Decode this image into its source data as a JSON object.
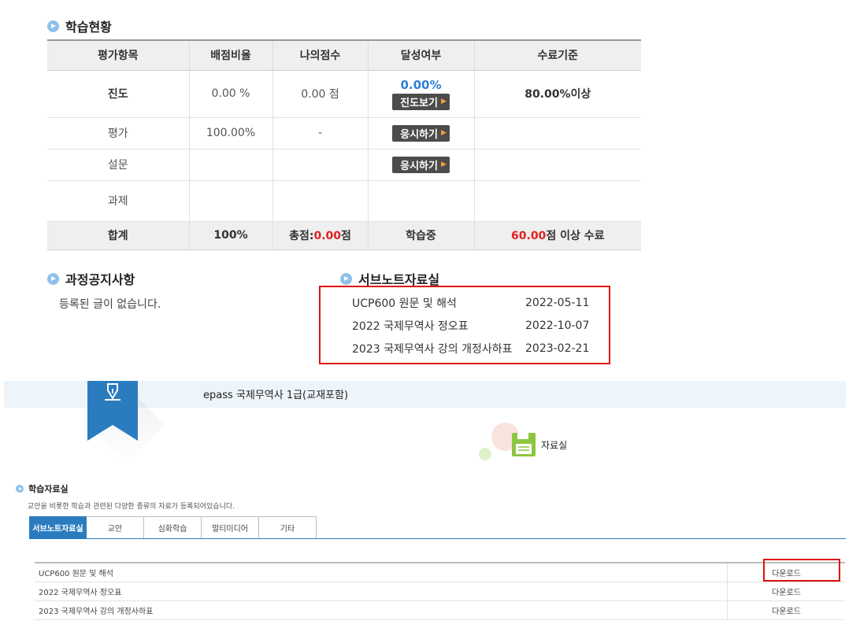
{
  "status": {
    "title": "학습현황",
    "headers": [
      "평가항목",
      "배점비율",
      "나의점수",
      "달성여부",
      "수료기준"
    ],
    "rows": [
      {
        "item": "진도",
        "ratio": "0.00 %",
        "score": "0.00 점",
        "achieve_pct": "0.00%",
        "button": "진도보기",
        "criteria": "80.00%이상"
      },
      {
        "item": "평가",
        "ratio": "100.00%",
        "score": "-",
        "button": "응시하기",
        "criteria": ""
      },
      {
        "item": "설문",
        "ratio": "",
        "score": "",
        "button": "응시하기",
        "criteria": ""
      },
      {
        "item": "과제",
        "ratio": "",
        "score": "",
        "criteria": ""
      }
    ],
    "total": {
      "item": "합계",
      "ratio": "100%",
      "score_prefix": "총점:",
      "score_value": "0.00",
      "score_suffix": "점",
      "state": "학습중",
      "criteria_value": "60.00",
      "criteria_suffix": "점 이상 수료"
    }
  },
  "notice": {
    "title": "과정공지사항",
    "empty": "등록된 글이 없습니다."
  },
  "subnote": {
    "title": "서브노트자료실",
    "items": [
      {
        "title": "UCP600 원문 및 해석",
        "date": "2022-05-11"
      },
      {
        "title": "2022 국제무역사 정오표",
        "date": "2022-10-07"
      },
      {
        "title": "2023 국제무역사 강의 개정사하표",
        "date": "2023-02-21"
      }
    ]
  },
  "course": {
    "name": "epass 국제무역사 1급(교재포함)",
    "library_label": "자료실"
  },
  "library": {
    "title": "학습자료실",
    "description": "교안을 비롯한 학습과 관련된 다양한 종류의 자료가 등록되어있습니다.",
    "tabs": [
      "서브노트자료실",
      "교안",
      "심화학습",
      "멀티미디어",
      "기타"
    ],
    "rows": [
      {
        "title": "UCP600 원문 및 해석",
        "download": "다운로드"
      },
      {
        "title": "2022 국제무역사 정오표",
        "download": "다운로드"
      },
      {
        "title": "2023 국제무역사 강의 개정사하표",
        "download": "다운로드"
      }
    ]
  },
  "colors": {
    "accent": "#2b7cbf",
    "highlight": "#e01010",
    "pct": "#2f7fd3"
  }
}
